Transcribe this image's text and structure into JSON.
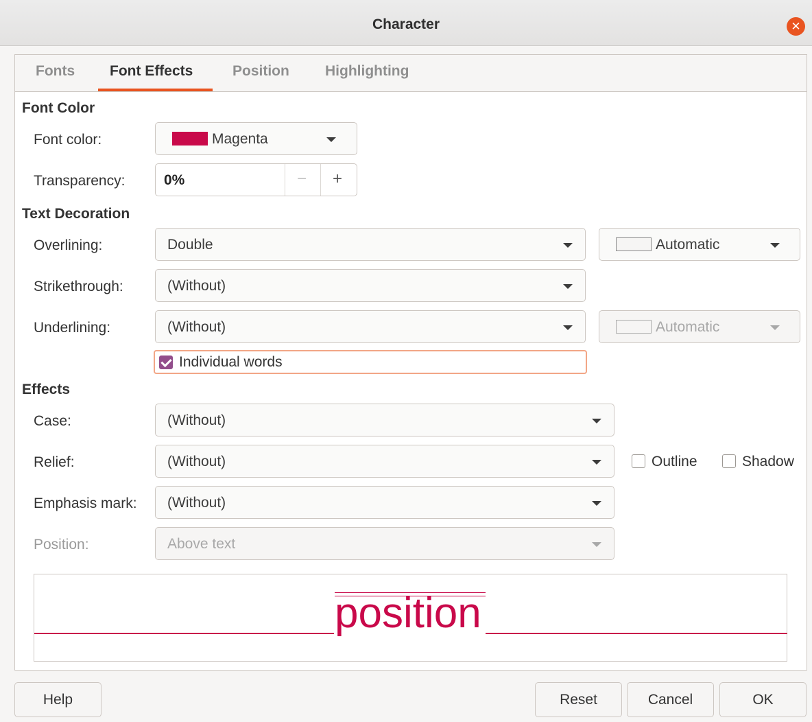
{
  "window": {
    "title": "Character"
  },
  "tabs": [
    "Fonts",
    "Font Effects",
    "Position",
    "Highlighting"
  ],
  "active_tab": "Font Effects",
  "font_color_section": {
    "heading": "Font Color",
    "font_color_label": "Font color:",
    "font_color_value": "Magenta",
    "font_color_swatch": "#c9094a",
    "transparency_label": "Transparency:",
    "transparency_value": "0%",
    "minus": "−",
    "plus": "+"
  },
  "text_decoration": {
    "heading": "Text Decoration",
    "overlining_label": "Overlining:",
    "overlining_value": "Double",
    "overline_color": "Automatic",
    "strikethrough_label": "Strikethrough:",
    "strikethrough_value": "(Without)",
    "underlining_label": "Underlining:",
    "underlining_value": "(Without)",
    "underline_color": "Automatic",
    "individual_words_label": "Individual words",
    "individual_words_checked": true
  },
  "effects": {
    "heading": "Effects",
    "case_label": "Case:",
    "case_value": "(Without)",
    "relief_label": "Relief:",
    "relief_value": "(Without)",
    "outline_label": "Outline",
    "shadow_label": "Shadow",
    "emphasis_label": "Emphasis mark:",
    "emphasis_value": "(Without)",
    "position_label": "Position:",
    "position_value": "Above text"
  },
  "preview": {
    "text": "position",
    "color": "#c9094a"
  },
  "buttons": {
    "help": "Help",
    "reset": "Reset",
    "cancel": "Cancel",
    "ok": "OK"
  },
  "colors": {
    "accent": "#e95420",
    "checkbox": "#924d8b"
  }
}
